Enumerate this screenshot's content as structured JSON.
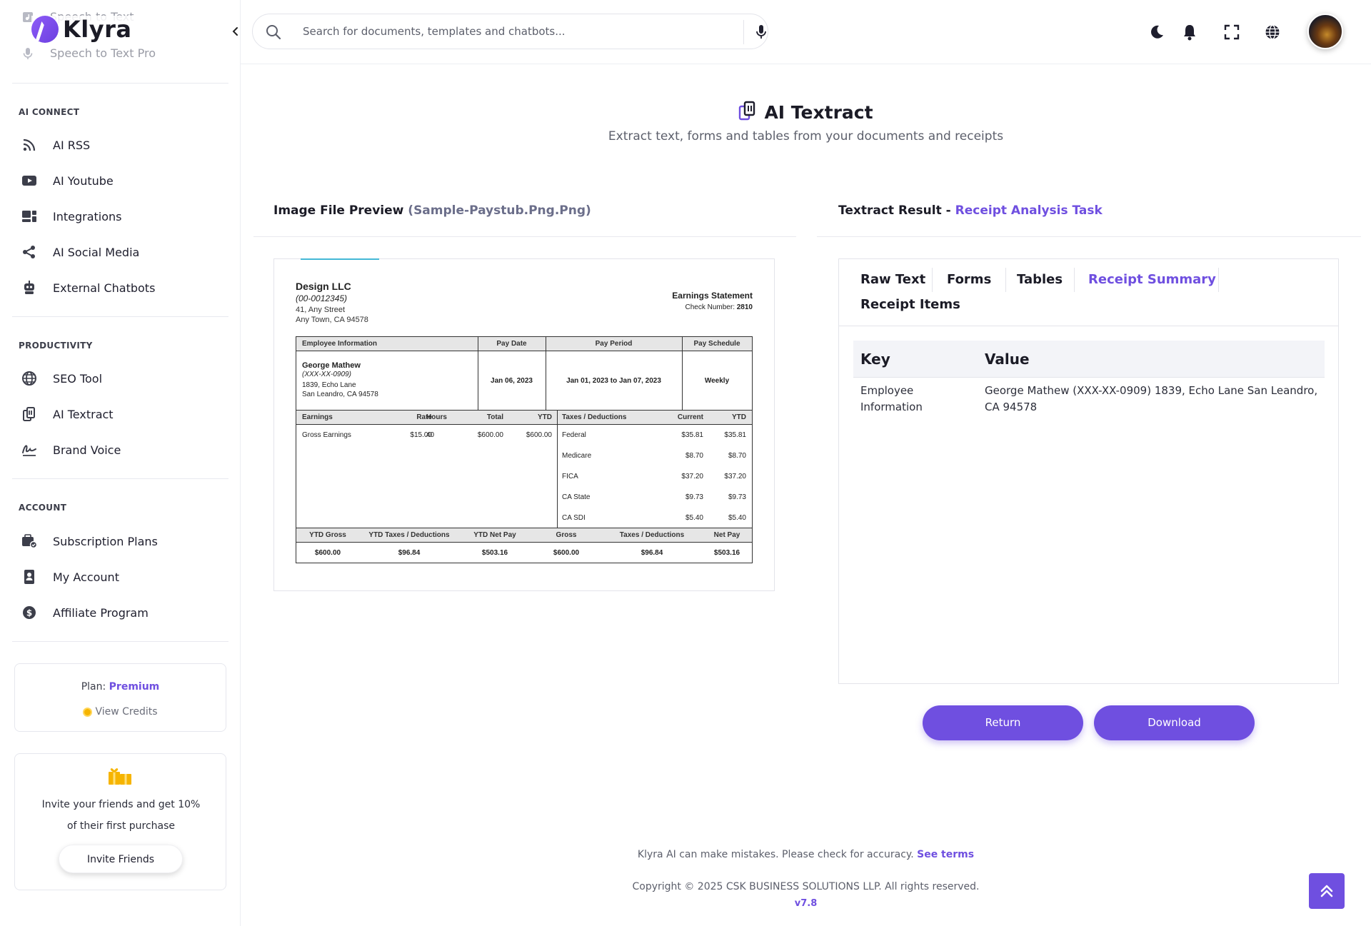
{
  "brand": {
    "name": "Klyra",
    "accent": "#6f4fe0"
  },
  "sidebar": {
    "ghost_items": [
      "Speech to Text",
      "Speech to Text Pro"
    ],
    "sections": [
      {
        "label": "AI CONNECT",
        "items": [
          {
            "label": "AI RSS",
            "icon": "rss-icon"
          },
          {
            "label": "AI Youtube",
            "icon": "youtube-icon"
          },
          {
            "label": "Integrations",
            "icon": "integrations-icon"
          },
          {
            "label": "AI Social Media",
            "icon": "share-icon"
          },
          {
            "label": "External Chatbots",
            "icon": "robot-icon"
          }
        ]
      },
      {
        "label": "PRODUCTIVITY",
        "items": [
          {
            "label": "SEO Tool",
            "icon": "globe-grid-icon"
          },
          {
            "label": "AI Textract",
            "icon": "textract-icon"
          },
          {
            "label": "Brand Voice",
            "icon": "signature-icon"
          }
        ]
      },
      {
        "label": "ACCOUNT",
        "items": [
          {
            "label": "Subscription Plans",
            "icon": "subscription-icon"
          },
          {
            "label": "My Account",
            "icon": "id-card-icon"
          },
          {
            "label": "Affiliate Program",
            "icon": "dollar-badge-icon"
          }
        ]
      }
    ],
    "plan": {
      "prefix": "Plan:",
      "name": "Premium",
      "credits_link": "View Credits"
    },
    "invite": {
      "text": "Invite your friends and get 10% of their first purchase",
      "button": "Invite Friends"
    }
  },
  "topbar": {
    "search_placeholder": "Search for documents, templates and chatbots..."
  },
  "page": {
    "title": "AI Textract",
    "subtitle": "Extract text, forms and tables from your documents and receipts"
  },
  "preview": {
    "heading": "Image File Preview",
    "filename": "(Sample-Paystub.Png.Png)",
    "stub": {
      "company": "Design LLC",
      "company_id": "(00-0012345)",
      "address1": "41, Any Street",
      "address2": "Any Town, CA 94578",
      "statement_title": "Earnings Statement",
      "check_label": "Check Number:",
      "check_number": "2810",
      "info_headers": [
        "Employee Information",
        "Pay Date",
        "Pay Period",
        "Pay Schedule"
      ],
      "employee_name": "George Mathew",
      "employee_id": "(XXX-XX-0909)",
      "employee_addr1": "1839, Echo Lane",
      "employee_addr2": "San Leandro, CA 94578",
      "pay_date": "Jan 06, 2023",
      "pay_period": "Jan 01, 2023 to Jan 07, 2023",
      "pay_schedule": "Weekly",
      "earnings_headers": [
        "Earnings",
        "Rate",
        "Hours",
        "Total",
        "YTD"
      ],
      "earnings_row": [
        "Gross Earnings",
        "$15.00",
        "40",
        "$600.00",
        "$600.00"
      ],
      "tax_headers": [
        "Taxes / Deductions",
        "Current",
        "YTD"
      ],
      "tax_rows": [
        [
          "Federal",
          "$35.81",
          "$35.81"
        ],
        [
          "Medicare",
          "$8.70",
          "$8.70"
        ],
        [
          "FICA",
          "$37.20",
          "$37.20"
        ],
        [
          "CA State",
          "$9.73",
          "$9.73"
        ],
        [
          "CA SDI",
          "$5.40",
          "$5.40"
        ]
      ],
      "summary_headers": [
        "YTD Gross",
        "YTD Taxes / Deductions",
        "YTD Net Pay",
        "Gross",
        "Taxes / Deductions",
        "Net Pay"
      ],
      "summary_values": [
        "$600.00",
        "$96.84",
        "$503.16",
        "$600.00",
        "$96.84",
        "$503.16"
      ]
    }
  },
  "result": {
    "heading": "Textract Result -",
    "task": "Receipt Analysis Task",
    "tabs": [
      "Raw Text",
      "Forms",
      "Tables",
      "Receipt Summary",
      "Receipt Items"
    ],
    "active_tab": "Receipt Summary",
    "table_headers": [
      "Key",
      "Value"
    ],
    "rows": [
      {
        "key": "Employee Information",
        "value": "George Mathew (XXX-XX-0909) 1839, Echo Lane San Leandro, CA 94578"
      }
    ],
    "return_button": "Return",
    "download_button": "Download"
  },
  "footer": {
    "disclaimer": "Klyra AI can make mistakes. Please check for accuracy.",
    "terms_link": "See terms",
    "copyright": "Copyright © 2025 CSK BUSINESS SOLUTIONS LLP. All rights reserved.",
    "version": "v7.8"
  }
}
